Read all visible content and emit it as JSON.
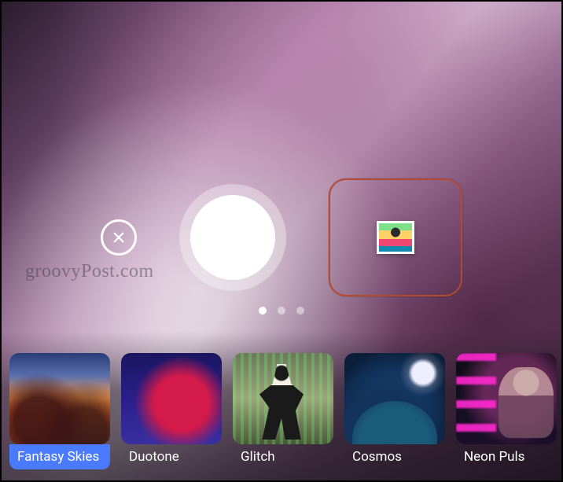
{
  "watermark": "groovyPost.com",
  "controls": {
    "close_icon": "close",
    "shutter": "shutter",
    "gallery": "gallery-thumbnail"
  },
  "pager": {
    "count": 3,
    "active_index": 0
  },
  "filters": [
    {
      "id": "fantasy-skies",
      "label": "Fantasy Skies",
      "thumb_class": "thumb-fantasy",
      "selected": true
    },
    {
      "id": "duotone",
      "label": "Duotone",
      "thumb_class": "thumb-duotone",
      "selected": false
    },
    {
      "id": "glitch",
      "label": "Glitch",
      "thumb_class": "thumb-glitch",
      "selected": false
    },
    {
      "id": "cosmos",
      "label": "Cosmos",
      "thumb_class": "thumb-cosmos",
      "selected": false
    },
    {
      "id": "neon-pulse",
      "label": "Neon Puls",
      "thumb_class": "thumb-neon",
      "selected": false
    }
  ]
}
